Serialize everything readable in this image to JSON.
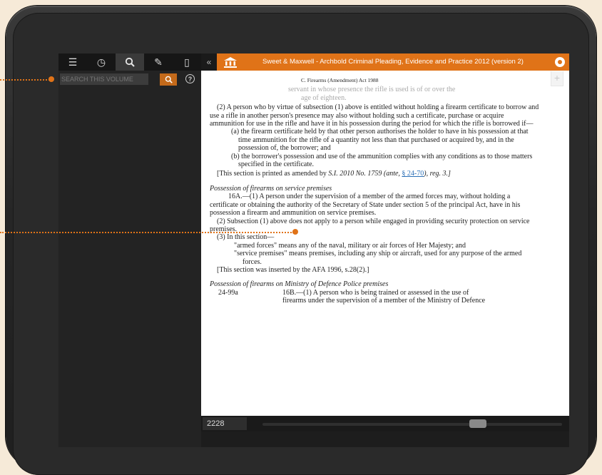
{
  "app": {
    "title": "Sweet & Maxwell - Archbold Criminal Pleading, Evidence and Practice 2012 (version 2)"
  },
  "toolbar": {
    "tools": [
      {
        "icon": "list-icon",
        "glyph": "☰"
      },
      {
        "icon": "history-icon",
        "glyph": "◷"
      },
      {
        "icon": "search-icon",
        "glyph": "⚲"
      },
      {
        "icon": "notes-icon",
        "glyph": "✎"
      },
      {
        "icon": "bookmark-icon",
        "glyph": "▯"
      }
    ],
    "active_tool": "search-icon"
  },
  "search": {
    "placeholder": "SEARCH THIS VOLUME",
    "help_label": "?"
  },
  "doc": {
    "header": "C. Firearms (Amendment) Act 1988",
    "faded_line_1": "servant in whose presence the rifle is used is of or over the",
    "faded_line_2": "age of eighteen.",
    "para2": "(2) A person who by virtue of subsection (1) above is entitled without holding a firearm certificate to borrow and use a rifle in another person's presence may also without holding such a certificate, purchase or acquire ammunition for use in the rifle and have it in his possession during the period for which the rifle is borrowed if—",
    "item_a": "(a) the firearm certificate held by that other person authorises the holder to have in his possession at that time ammunition for the rifle of a quantity not less than that purchased or acquired by, and in the possession of, the borrower; and",
    "item_b": "(b) the borrower's possession and use of the ammunition complies with any conditions as to those matters specified in the certificate.",
    "amend_pre": "[This section is printed as amended by ",
    "amend_ref": "S.I. 2010 No. 1759",
    "amend_ante": " (ante, ",
    "amend_link": "§ 24-70",
    "amend_post": "), reg. 3.]",
    "heading1": "Possession of firearms on service premises",
    "s16a_1": "16A.—(1) A person under the supervision of a member of the armed forces may, without holding a certificate or obtaining the authority of the Secretary of State under section 5 of the principal Act, have in his possession a firearm and ammunition on service premises.",
    "s16a_2": "(2) Subsection (1) above does not apply to a person while engaged in providing security protection on service premises.",
    "s16a_3": "(3) In this section—",
    "def1": "\"armed forces\" means any of the naval, military or air forces of Her Majesty; and",
    "def2": "\"service premises\" means premises, including any ship or aircraft, used for any purpose of the armed forces.",
    "inserted_note": "[This section was inserted by the AFA 1996, s.28(2).]",
    "heading2": "Possession of firearms on Ministry of Defence Police premises",
    "margin_ref": "24-99a",
    "s16b_1": "16B.—(1) A person who is being trained or assessed in the use of",
    "s16b_cut": "firearms under the supervision of a member of the Ministry of Defence"
  },
  "bottom": {
    "page_number": "2228",
    "slider_position": 0.72
  },
  "colors": {
    "accent": "#e07318",
    "panel_dark": "#232323",
    "link": "#2b6fb6"
  }
}
